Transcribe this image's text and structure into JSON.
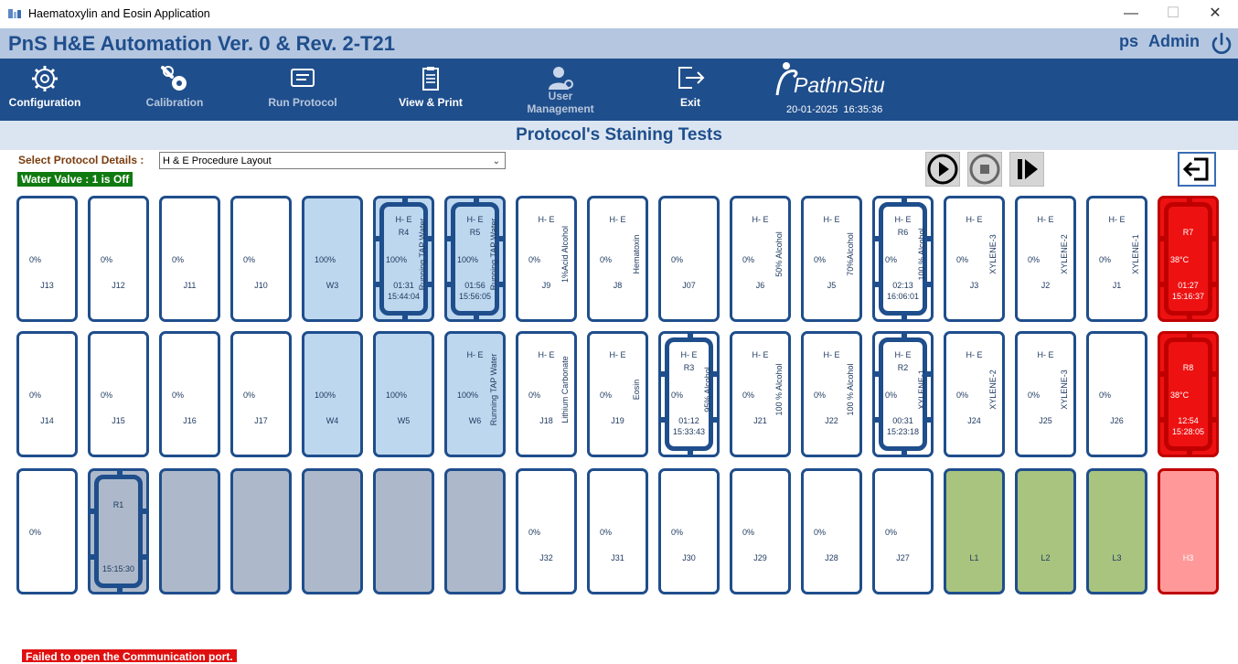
{
  "window": {
    "title": "Haematoxylin and Eosin Application",
    "minimize": "—",
    "maximize": "☐",
    "close": "✕"
  },
  "header": {
    "app_title": "PnS H&E Automation Ver. 0 & Rev. 2-T21",
    "user_short": "ps",
    "user_role": "Admin"
  },
  "nav": {
    "configuration": "Configuration",
    "calibration": "Calibration",
    "run_protocol": "Run Protocol",
    "view_print": "View & Print",
    "user_management": "User Management",
    "exit": "Exit",
    "logo": "PathnSitu",
    "date": "20-01-2025",
    "time": "16:35:36"
  },
  "section_title": "Protocol's Staining Tests",
  "protocol": {
    "label": "Select Protocol Details :",
    "selected": "H & E Procedure Layout"
  },
  "water_valve": "Water Valve : 1 is Off",
  "status_message": "Failed to open the Communication port.",
  "rows": [
    [
      {
        "code": "J13",
        "pct": "0%"
      },
      {
        "code": "J12",
        "pct": "0%"
      },
      {
        "code": "J11",
        "pct": "0%"
      },
      {
        "code": "J10",
        "pct": "0%"
      },
      {
        "code": "W3",
        "pct": "100%",
        "color": "blue"
      },
      {
        "pct": "100%",
        "color": "blue",
        "he": "H- E",
        "rack": {
          "id": "R4",
          "time": "01:31",
          "clock": "15:44:04"
        },
        "reagent": "Running TAP Water"
      },
      {
        "pct": "100%",
        "color": "blue",
        "he": "H- E",
        "rack": {
          "id": "R5",
          "time": "01:56",
          "clock": "15:56:05"
        },
        "reagent": "Running TAP Water"
      },
      {
        "code": "J9",
        "pct": "0%",
        "he": "H- E",
        "reagent": "1%Acid Alcohol"
      },
      {
        "code": "J8",
        "pct": "0%",
        "he": "H- E",
        "reagent": "Hematoxin"
      },
      {
        "code": "J07",
        "pct": "0%"
      },
      {
        "code": "J6",
        "pct": "0%",
        "he": "H- E",
        "reagent": "50% Alcohol"
      },
      {
        "code": "J5",
        "pct": "0%",
        "he": "H- E",
        "reagent": "70%Alcohol"
      },
      {
        "pct": "0%",
        "he": "H- E",
        "rack": {
          "id": "R6",
          "time": "02:13",
          "clock": "16:06:01"
        },
        "reagent": "100 % Alcohol"
      },
      {
        "code": "J3",
        "pct": "0%",
        "he": "H- E",
        "reagent": "XYLENE-3"
      },
      {
        "code": "J2",
        "pct": "0%",
        "he": "H- E",
        "reagent": "XYLENE-2"
      },
      {
        "code": "J1",
        "pct": "0%",
        "he": "H- E",
        "reagent": "XYLENE-1"
      },
      {
        "color": "red",
        "rack": {
          "id": "R7",
          "temp": "38°C",
          "time": "01:27",
          "clock": "15:16:37"
        }
      }
    ],
    [
      {
        "code": "J14",
        "pct": "0%"
      },
      {
        "code": "J15",
        "pct": "0%"
      },
      {
        "code": "J16",
        "pct": "0%"
      },
      {
        "code": "J17",
        "pct": "0%"
      },
      {
        "code": "W4",
        "pct": "100%",
        "color": "blue"
      },
      {
        "code": "W5",
        "pct": "100%",
        "color": "blue"
      },
      {
        "code": "W6",
        "pct": "100%",
        "color": "blue",
        "he": "H- E",
        "reagent": "Running TAP Water"
      },
      {
        "code": "J18",
        "pct": "0%",
        "he": "H- E",
        "reagent": "Lithium Carbonate"
      },
      {
        "code": "J19",
        "pct": "0%",
        "he": "H- E",
        "reagent": "Eosin"
      },
      {
        "pct": "0%",
        "he": "H- E",
        "rack": {
          "id": "R3",
          "time": "01:12",
          "clock": "15:33:43"
        },
        "reagent": "95% Alcohol"
      },
      {
        "code": "J21",
        "pct": "0%",
        "he": "H- E",
        "reagent": "100 % Alcohol"
      },
      {
        "code": "J22",
        "pct": "0%",
        "he": "H- E",
        "reagent": "100 % Alcohol"
      },
      {
        "pct": "0%",
        "he": "H- E",
        "rack": {
          "id": "R2",
          "time": "00:31",
          "clock": "15:23:18"
        },
        "reagent": "XYLENE-1"
      },
      {
        "code": "J24",
        "pct": "0%",
        "he": "H- E",
        "reagent": "XYLENE-2"
      },
      {
        "code": "J25",
        "pct": "0%",
        "he": "H- E",
        "reagent": "XYLENE-3"
      },
      {
        "code": "J26",
        "pct": "0%"
      },
      {
        "color": "red",
        "rack": {
          "id": "R8",
          "temp": "38°C",
          "time": "12:54",
          "clock": "15:28:05"
        }
      }
    ],
    [
      {
        "pct": "0%"
      },
      {
        "color": "grey",
        "rack": {
          "id": "R1",
          "clock": "15:15:30"
        }
      },
      {
        "color": "grey"
      },
      {
        "color": "grey"
      },
      {
        "color": "grey"
      },
      {
        "color": "grey"
      },
      {
        "color": "grey"
      },
      {
        "code": "J32",
        "pct": "0%"
      },
      {
        "code": "J31",
        "pct": "0%"
      },
      {
        "code": "J30",
        "pct": "0%"
      },
      {
        "code": "J29",
        "pct": "0%"
      },
      {
        "code": "J28",
        "pct": "0%"
      },
      {
        "code": "J27",
        "pct": "0%"
      },
      {
        "code": "L1",
        "color": "green"
      },
      {
        "code": "L2",
        "color": "green"
      },
      {
        "code": "L3",
        "color": "green"
      },
      {
        "code": "H3",
        "color": "pink"
      }
    ]
  ]
}
